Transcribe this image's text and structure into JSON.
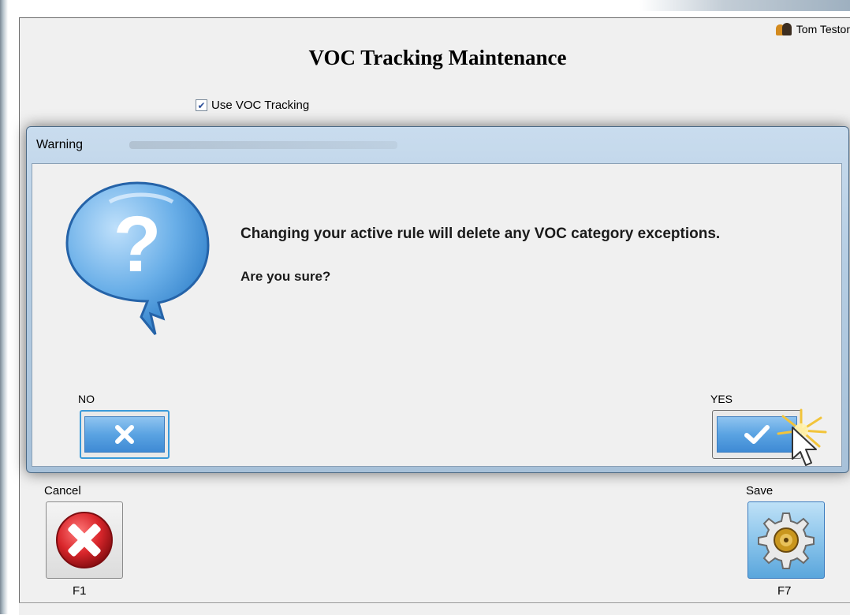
{
  "header": {
    "user_name": "Tom Testor",
    "title": "VOC Tracking Maintenance"
  },
  "voc": {
    "checkbox_label": "Use VOC Tracking",
    "checked": true
  },
  "dialog": {
    "title": "Warning",
    "message": "Changing your active rule will delete any VOC category exceptions.",
    "question": "Are you sure?",
    "no_label": "NO",
    "yes_label": "YES"
  },
  "toolbar": {
    "cancel_label": "Cancel",
    "cancel_key": "F1",
    "save_label": "Save",
    "save_key": "F7"
  },
  "colors": {
    "dialog_frame": "#b5cde3",
    "button_blue": "#5aa3e2",
    "cancel_red": "#d9262b"
  }
}
